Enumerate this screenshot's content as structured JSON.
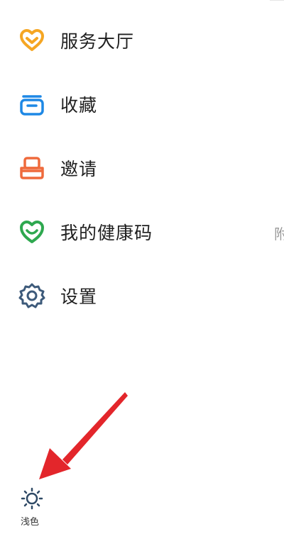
{
  "menu": {
    "items": [
      {
        "label": "服务大厅",
        "icon": "heart-outline-icon",
        "color": "#f5a623"
      },
      {
        "label": "收藏",
        "icon": "folder-icon",
        "color": "#1e88e5"
      },
      {
        "label": "邀请",
        "icon": "inbox-tray-icon",
        "color": "#ef6a3c"
      },
      {
        "label": "我的健康码",
        "icon": "smile-heart-icon",
        "color": "#2ea84f"
      },
      {
        "label": "设置",
        "icon": "gear-icon",
        "color": "#3d5a7a"
      }
    ]
  },
  "edge_text": "附",
  "theme_toggle": {
    "label": "浅色",
    "icon": "sun-icon",
    "color": "#2f4a66"
  },
  "annotation": {
    "arrow_color": "#e3262b"
  }
}
